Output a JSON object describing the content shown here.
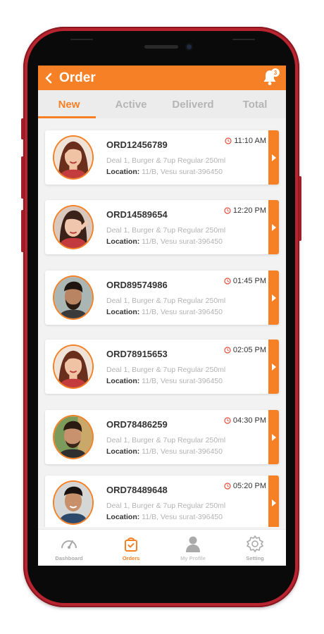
{
  "app": {
    "title": "Order",
    "notification_count": "3"
  },
  "colors": {
    "accent": "#f58025",
    "frame": "#b8242f"
  },
  "tabs": [
    {
      "label": "New",
      "active": true
    },
    {
      "label": "Active",
      "active": false
    },
    {
      "label": "Deliverd",
      "active": false
    },
    {
      "label": "Total",
      "active": false
    }
  ],
  "orders": [
    {
      "id": "ORD12456789",
      "time": "11:10 AM",
      "items": "Deal 1, Burger & 7up Regular 250ml",
      "location_label": "Location:",
      "location": " 11/B, Vesu surat-396450"
    },
    {
      "id": "ORD14589654",
      "time": "12:20 PM",
      "items": "Deal 1, Burger & 7up Regular 250ml",
      "location_label": "Location:",
      "location": " 11/B, Vesu surat-396450"
    },
    {
      "id": "ORD89574986",
      "time": "01:45 PM",
      "items": "Deal 1, Burger & 7up Regular 250ml",
      "location_label": "Location:",
      "location": " 11/B, Vesu surat-396450"
    },
    {
      "id": "ORD78915653",
      "time": "02:05 PM",
      "items": "Deal 1, Burger & 7up Regular 250ml",
      "location_label": "Location:",
      "location": " 11/B, Vesu surat-396450"
    },
    {
      "id": "ORD78486259",
      "time": "04:30 PM",
      "items": "Deal 1, Burger & 7up Regular 250ml",
      "location_label": "Location:",
      "location": " 11/B, Vesu surat-396450"
    },
    {
      "id": "ORD78489648",
      "time": "05:20 PM",
      "items": "Deal 1, Burger & 7up Regular 250ml",
      "location_label": "Location:",
      "location": " 11/B, Vesu surat-396450"
    }
  ],
  "bottom_nav": [
    {
      "label": "Dashboard",
      "icon": "gauge-icon",
      "active": false
    },
    {
      "label": "Orders",
      "icon": "shopping-bag-icon",
      "active": true
    },
    {
      "label": "My Profile",
      "icon": "user-icon",
      "active": false
    },
    {
      "label": "Setting",
      "icon": "gear-icon",
      "active": false
    }
  ]
}
